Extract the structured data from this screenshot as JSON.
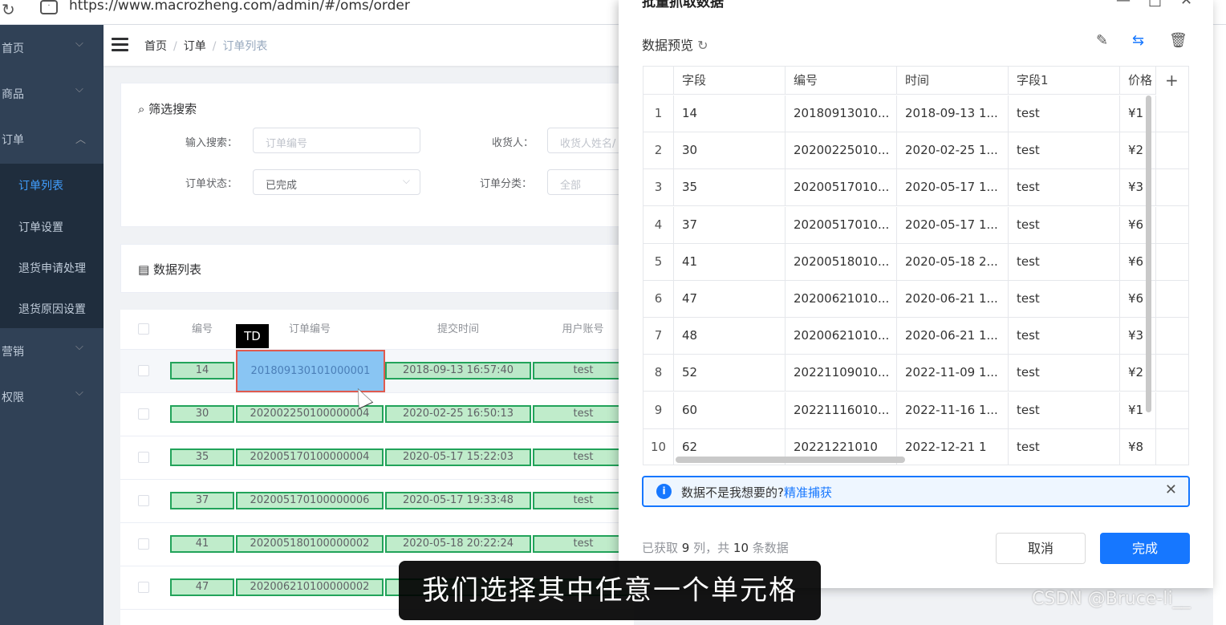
{
  "browser": {
    "url": "https://www.macrozheng.com/admin/#/oms/order"
  },
  "sidebar": {
    "menus": [
      {
        "label": "首页"
      },
      {
        "label": "商品"
      },
      {
        "label": "订单"
      },
      {
        "label": "营销"
      },
      {
        "label": "权限"
      }
    ],
    "submenu": [
      {
        "label": "订单列表"
      },
      {
        "label": "订单设置"
      },
      {
        "label": "退货申请处理"
      },
      {
        "label": "退货原因设置"
      }
    ]
  },
  "breadcrumb": {
    "home": "首页",
    "section": "订单",
    "current": "订单列表",
    "sep": "/"
  },
  "filter": {
    "title": "筛选搜索",
    "search_label": "输入搜索：",
    "search_placeholder": "订单编号",
    "receiver_label": "收货人：",
    "receiver_placeholder": "收货人姓名/",
    "status_label": "订单状态：",
    "status_value": "已完成",
    "category_label": "订单分类：",
    "category_placeholder": "全部"
  },
  "list": {
    "title": "数据列表",
    "headers": [
      "编号",
      "订单编号",
      "提交时间",
      "用户账号"
    ],
    "rows": [
      {
        "id": "14",
        "order_no": "201809130101000001",
        "time": "2018-09-13 16:57:40",
        "user": "test"
      },
      {
        "id": "30",
        "order_no": "202002250100000004",
        "time": "2020-02-25 16:50:13",
        "user": "test"
      },
      {
        "id": "35",
        "order_no": "202005170100000004",
        "time": "2020-05-17 15:22:03",
        "user": "test"
      },
      {
        "id": "37",
        "order_no": "202005170100000006",
        "time": "2020-05-17 19:33:48",
        "user": "test"
      },
      {
        "id": "41",
        "order_no": "202005180100000002",
        "time": "2020-05-18 20:22:24",
        "user": "test"
      },
      {
        "id": "47",
        "order_no": "202006210100000002",
        "time": "",
        "user": ""
      }
    ],
    "tooltip": "TD"
  },
  "dialog": {
    "title": "批量抓取数据",
    "preview_title": "数据预览",
    "columns": [
      "字段",
      "编号",
      "时间",
      "字段1",
      "价格"
    ],
    "rows": [
      {
        "n": "1",
        "f": "14",
        "no": "20180913010...",
        "t": "2018-09-13 1...",
        "f1": "test",
        "p": "¥1"
      },
      {
        "n": "2",
        "f": "30",
        "no": "20200225010...",
        "t": "2020-02-25 1...",
        "f1": "test",
        "p": "¥2"
      },
      {
        "n": "3",
        "f": "35",
        "no": "20200517010...",
        "t": "2020-05-17 1...",
        "f1": "test",
        "p": "¥3"
      },
      {
        "n": "4",
        "f": "37",
        "no": "20200517010...",
        "t": "2020-05-17 1...",
        "f1": "test",
        "p": "¥6"
      },
      {
        "n": "5",
        "f": "41",
        "no": "20200518010...",
        "t": "2020-05-18 2...",
        "f1": "test",
        "p": "¥6"
      },
      {
        "n": "6",
        "f": "47",
        "no": "20200621010...",
        "t": "2020-06-21 1...",
        "f1": "test",
        "p": "¥6"
      },
      {
        "n": "7",
        "f": "48",
        "no": "20200621010...",
        "t": "2020-06-21 1...",
        "f1": "test",
        "p": "¥3"
      },
      {
        "n": "8",
        "f": "52",
        "no": "20221109010...",
        "t": "2022-11-09 1...",
        "f1": "test",
        "p": "¥2"
      },
      {
        "n": "9",
        "f": "60",
        "no": "20221116010...",
        "t": "2022-11-16 1...",
        "f1": "test",
        "p": "¥1"
      },
      {
        "n": "10",
        "f": "62",
        "no": "20221221010",
        "t": "2022-12-21 1",
        "f1": "test",
        "p": "¥8"
      }
    ],
    "notice_text": "数据不是我想要的?",
    "notice_link": "精准捕获",
    "summary_prefix": "已获取",
    "summary_cols": "9",
    "summary_mid": "列，共",
    "summary_rows": "10",
    "summary_suffix": "条数据",
    "cancel_label": "取消",
    "ok_label": "完成"
  },
  "subtitle": "我们选择其中任意一个单元格",
  "watermark": "CSDN @Bruce-li__"
}
